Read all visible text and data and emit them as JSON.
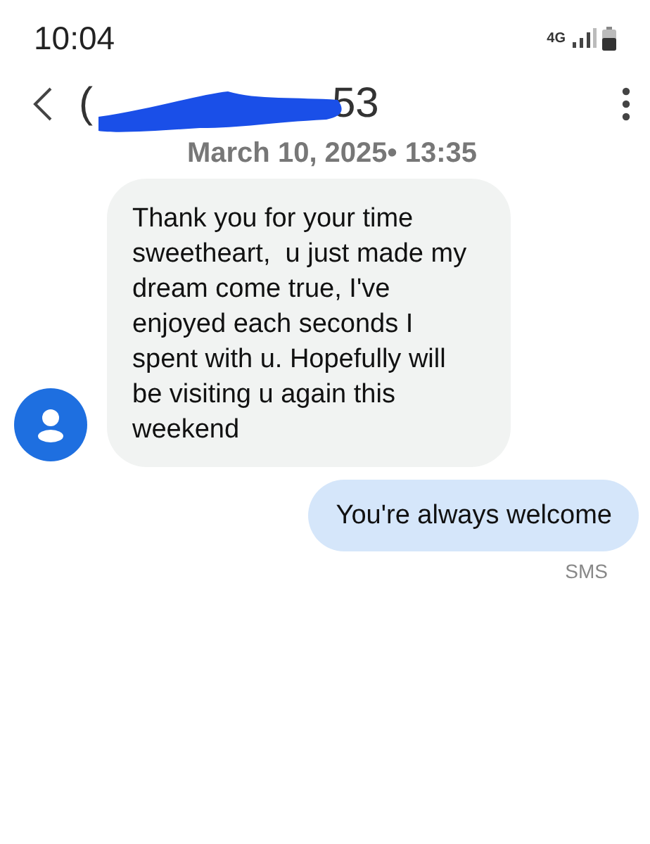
{
  "status_bar": {
    "time": "10:04",
    "network": "4G"
  },
  "header": {
    "title_parts": [
      "(",
      "53"
    ],
    "redacted": true,
    "date": "March 10, 2025• 13:35"
  },
  "messages": [
    {
      "kind": "incoming",
      "text": "Thank you for your time sweetheart,  u just made my dream come true, I've enjoyed each seconds I spent with u. Hopefully will be visiting u again this weekend"
    },
    {
      "kind": "outgoing",
      "text": "You're always welcome",
      "channel": "SMS"
    }
  ]
}
